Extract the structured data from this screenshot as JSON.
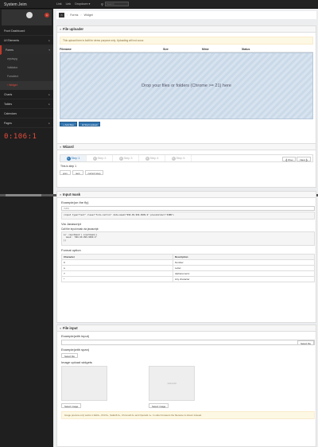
{
  "brand": "System Jeim",
  "topnav": {
    "link1": "Link",
    "link2": "Link",
    "dropdown": "Dropdown ▾",
    "search_placeholder": "Search"
  },
  "sidebar": {
    "items": [
      {
        "label": "Front Dashboard"
      },
      {
        "label": "UI Elements",
        "arrow": "▸"
      },
      {
        "label": "Forms",
        "arrow": "▾"
      }
    ],
    "forms_sub": [
      "wysiwyg",
      "Validator",
      "Forselect",
      "Widget"
    ],
    "items2": [
      {
        "label": "Charts",
        "arrow": "▸"
      },
      {
        "label": "Tables",
        "arrow": "▸"
      },
      {
        "label": "Calendars"
      },
      {
        "label": "Pages",
        "arrow": "▸"
      }
    ],
    "clock": "0:106:1",
    "badge": "1"
  },
  "breadcrumb": {
    "home": "⌂",
    "items": [
      "Forms",
      "Widget"
    ]
  },
  "uploader": {
    "title": "File uploader",
    "alert": "This upload form is built for demo purpose only. Uploading will not occur.",
    "columns": [
      "Filename",
      "Size",
      "Mime",
      "Status"
    ],
    "dropzone": "Drop your files or folders (Chrome >= 21) here",
    "add_files": "+ Add files",
    "start_upload": "⊕ Start upload"
  },
  "wizard": {
    "title": "Wizard",
    "steps": [
      "Step 1",
      "Step 2",
      "Step 3",
      "Step 4",
      "Step 5"
    ],
    "prev": "❮ Prev",
    "next": "Next ❯",
    "text": "This is step 1",
    "buttons": [
      "prev",
      "next",
      "current step"
    ]
  },
  "inputmask": {
    "title": "Input mask",
    "ex1_title": "Example(on the fly)",
    "ex1_placeholder": "ISBN",
    "ex1_code": "<input type=\"text\" class=\"form-control\" data-mask=\"999-99-999-9999-9\" placeholder=\"ISBN\">",
    "ex2_title": "Via Javascript",
    "ex2_label": "Call the input mask via javascript:",
    "ex2_code": "$('.inputmask').inputmask({\n  mask: '999-99-999-9999-9'\n})",
    "format_title": "Format option",
    "format_headers": [
      "Character",
      "Description"
    ],
    "format_rows": [
      [
        "9",
        "Number"
      ],
      [
        "a",
        "Letter"
      ],
      [
        "?",
        "Alphanumeric"
      ],
      [
        "*",
        "Any character"
      ]
    ]
  },
  "fileinput": {
    "title": "File input",
    "ex1_title": "Example(with input)",
    "select_file": "Select file",
    "ex2_title": "Example(with span)",
    "ex3_title": "Image upload widgets",
    "select_image": "Select image",
    "thumb_label": "140x140",
    "info": "Image preview only works in IE10+, FF3.6+, Safari6.0+, Chrome6.0+ and Opera11.1+. In older browsers the filename is shown instead."
  }
}
